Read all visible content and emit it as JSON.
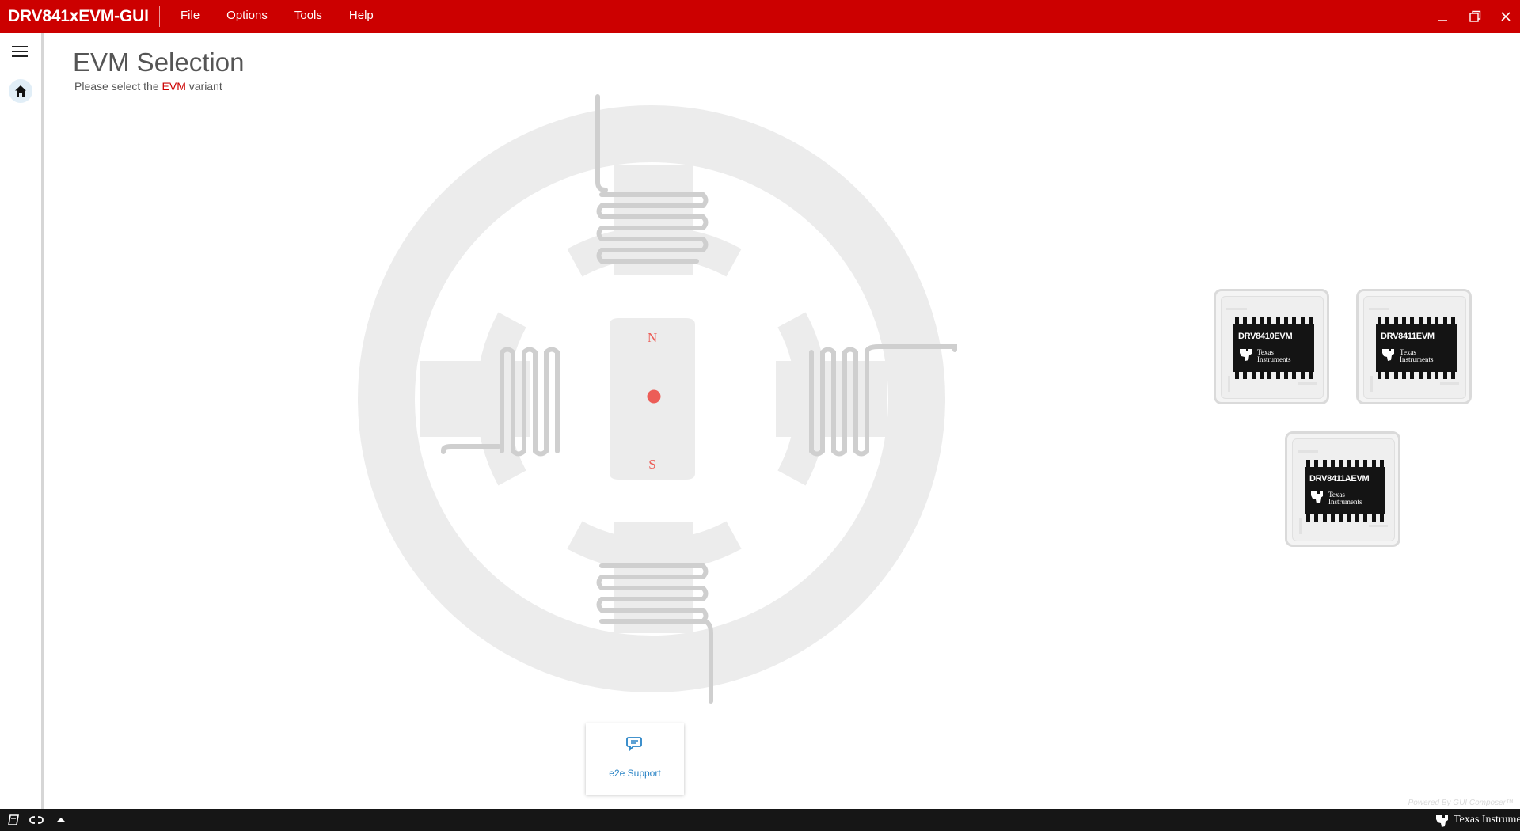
{
  "app": {
    "title": "DRV841xEVM-GUI"
  },
  "menu": {
    "file": "File",
    "options": "Options",
    "tools": "Tools",
    "help": "Help"
  },
  "page": {
    "title": "EVM Selection",
    "subtitle_prefix": "Please select the ",
    "subtitle_highlight": "EVM",
    "subtitle_suffix": " variant"
  },
  "motor": {
    "north_label": "N",
    "south_label": "S"
  },
  "evms": [
    {
      "name": "DRV8410EVM",
      "logo_line1": "Texas",
      "logo_line2": "Instruments"
    },
    {
      "name": "DRV8411EVM",
      "logo_line1": "Texas",
      "logo_line2": "Instruments"
    },
    {
      "name": "DRV8411AEVM",
      "logo_line1": "Texas",
      "logo_line2": "Instruments"
    }
  ],
  "support": {
    "label": "e2e Support"
  },
  "footer": {
    "powered_by": "Powered By GUI Composer™",
    "brand": "Texas Instruments"
  },
  "colors": {
    "brand_red": "#cc0000",
    "status_bar": "#161616",
    "motor_gray": "#ececec",
    "coil_gray": "#cfcfcf",
    "support_blue": "#2a84c6"
  }
}
